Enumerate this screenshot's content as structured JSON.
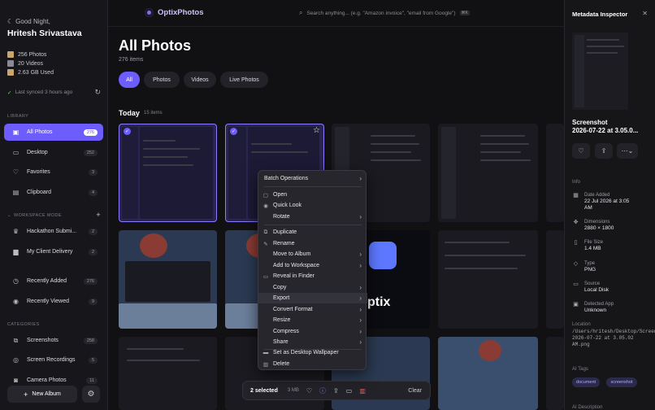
{
  "sidebar": {
    "greeting": "Good Night,",
    "user_name": "Hritesh Srivastava",
    "stats": [
      {
        "icon": "photo-stack-icon",
        "text": "256 Photos",
        "color": "#c9a66b"
      },
      {
        "icon": "video-icon",
        "text": "20 Videos",
        "color": "#8a8a94"
      },
      {
        "icon": "storage-icon",
        "text": "2.63 GB Used",
        "color": "#c9a66b"
      }
    ],
    "sync_text": "Last synced 3 hours ago",
    "library_label": "LIBRARY",
    "library": [
      {
        "label": "All Photos",
        "count": "276",
        "icon": "photos-icon"
      },
      {
        "label": "Desktop",
        "count": "252",
        "icon": "desktop-icon"
      },
      {
        "label": "Favorites",
        "count": "3",
        "icon": "heart-icon"
      },
      {
        "label": "Clipboard",
        "count": "4",
        "icon": "clipboard-icon"
      }
    ],
    "workspace_label": "WORKSPACE MODE",
    "workspaces": [
      {
        "label": "Hackathon Submi...",
        "count": "2",
        "icon": "trophy-icon"
      },
      {
        "label": "My Client Delivery",
        "count": "2",
        "icon": "briefcase-icon"
      }
    ],
    "recent": [
      {
        "label": "Recently Added",
        "count": "276",
        "icon": "clock-icon"
      },
      {
        "label": "Recently Viewed",
        "count": "9",
        "icon": "eye-icon"
      }
    ],
    "categories_label": "CATEGORIES",
    "categories": [
      {
        "label": "Screenshots",
        "count": "258",
        "icon": "screenshot-icon"
      },
      {
        "label": "Screen Recordings",
        "count": "5",
        "icon": "record-icon"
      },
      {
        "label": "Camera Photos",
        "count": "11",
        "icon": "camera-icon"
      }
    ],
    "new_album": "New Album"
  },
  "topbar": {
    "app_name": "OptixPhotos",
    "search_placeholder": "Search anything... (e.g. \"Amazon invoice\", \"email from Google\")",
    "search_kbd": "⌘K"
  },
  "main": {
    "title": "All Photos",
    "item_count": "276 items",
    "filters": [
      "All",
      "Photos",
      "Videos",
      "Live Photos"
    ],
    "active_filter": "All",
    "section_title": "Today",
    "section_count": "15 items",
    "tile_text": "ptix"
  },
  "context_menu": {
    "items": [
      {
        "label": "Batch Operations",
        "icon": "",
        "submenu": true
      },
      {
        "label": "Open",
        "icon": "open-icon",
        "submenu": false
      },
      {
        "label": "Quick Look",
        "icon": "eye-icon",
        "submenu": false
      },
      {
        "label": "Rotate",
        "icon": "",
        "submenu": true
      },
      {
        "label": "Duplicate",
        "icon": "duplicate-icon",
        "submenu": false
      },
      {
        "label": "Rename",
        "icon": "pencil-icon",
        "submenu": false
      },
      {
        "label": "Move to Album",
        "icon": "",
        "submenu": true
      },
      {
        "label": "Add to Workspace",
        "icon": "",
        "submenu": true
      },
      {
        "label": "Reveal in Finder",
        "icon": "folder-icon",
        "submenu": false
      },
      {
        "label": "Copy",
        "icon": "",
        "submenu": true
      },
      {
        "label": "Export",
        "icon": "",
        "submenu": true
      },
      {
        "label": "Convert Format",
        "icon": "",
        "submenu": true
      },
      {
        "label": "Resize",
        "icon": "",
        "submenu": true
      },
      {
        "label": "Compress",
        "icon": "",
        "submenu": true
      },
      {
        "label": "Share",
        "icon": "",
        "submenu": true
      },
      {
        "label": "Set as Desktop Wallpaper",
        "icon": "desktop-icon",
        "submenu": false
      },
      {
        "label": "Delete",
        "icon": "trash-icon",
        "submenu": false
      }
    ],
    "highlighted": "Export"
  },
  "bottom_bar": {
    "selected": "2 selected",
    "size": "3 MB",
    "clear": "Clear"
  },
  "inspector": {
    "title": "Metadata Inspector",
    "file_name_line1": "Screenshot",
    "file_name_line2": "2026-07-22 at 3.05.0...",
    "info_label": "Info",
    "rows": [
      {
        "icon": "calendar-icon",
        "label": "Date Added",
        "value": "22 Jul 2026 at 3:05 AM"
      },
      {
        "icon": "dimensions-icon",
        "label": "Dimensions",
        "value": "2880 × 1800"
      },
      {
        "icon": "file-icon",
        "label": "File Size",
        "value": "1.4 MB"
      },
      {
        "icon": "tag-icon",
        "label": "Type",
        "value": "PNG"
      },
      {
        "icon": "folder-icon",
        "label": "Source",
        "value": "Local Disk"
      },
      {
        "icon": "app-icon",
        "label": "Detected App",
        "value": "Unknown"
      }
    ],
    "location_label": "Location",
    "location": "/Users/hritesh/Desktop/Screenshot 2026-07-22 at 3.05.02 AM.png",
    "ai_tags_label": "AI Tags",
    "tags": [
      "document",
      "screenshot"
    ],
    "ai_desc_label": "AI Description"
  },
  "colors": {
    "accent": "#6d5dfc",
    "background": "#111114",
    "sidebar": "#17171b"
  }
}
